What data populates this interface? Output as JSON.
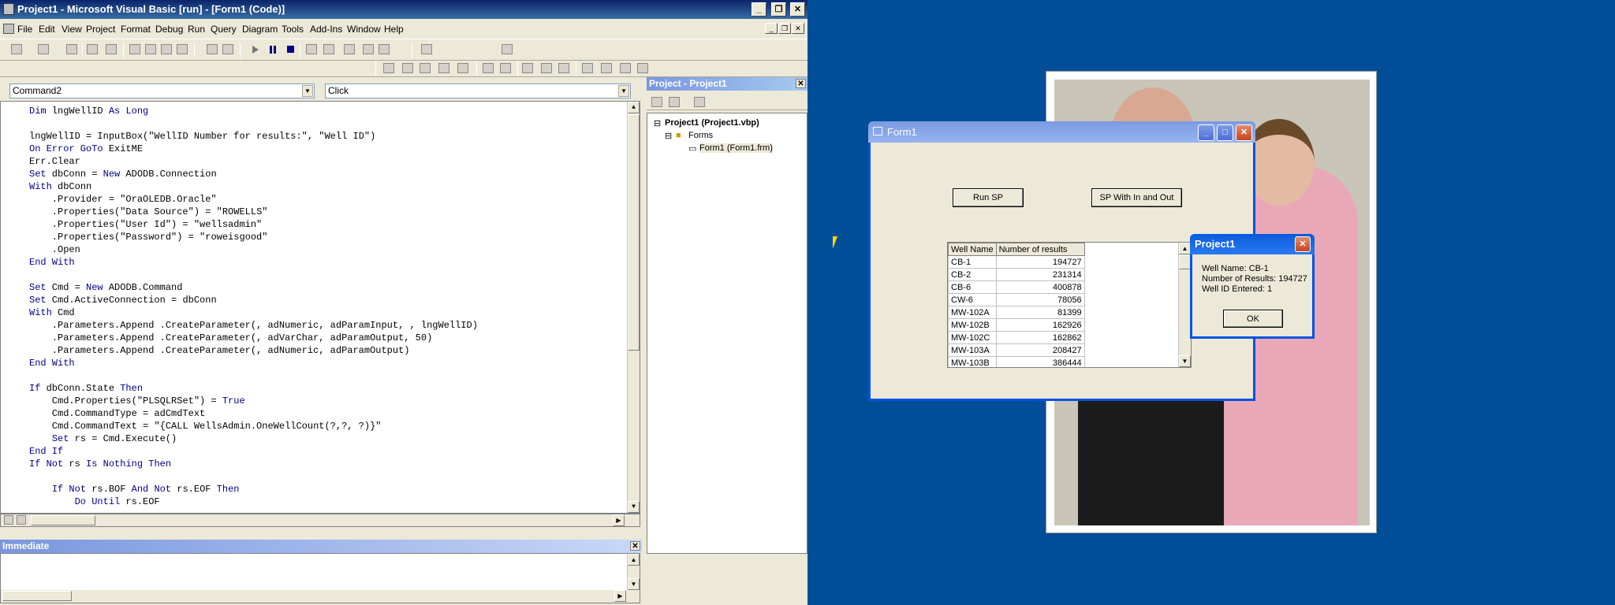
{
  "ide": {
    "title": "Project1 - Microsoft Visual Basic [run] - [Form1 (Code)]",
    "menu": [
      "File",
      "Edit",
      "View",
      "Project",
      "Format",
      "Debug",
      "Run",
      "Query",
      "Diagram",
      "Tools",
      "Add-Ins",
      "Window",
      "Help"
    ],
    "object_combo": "Command2",
    "proc_combo": "Click",
    "code_lines": [
      "Dim lngWellID As Long",
      "",
      "lngWellID = InputBox(\"WellID Number for results:\", \"Well ID\")",
      "On Error GoTo ExitME",
      "Err.Clear",
      "Set dbConn = New ADODB.Connection",
      "With dbConn",
      "    .Provider = \"OraOLEDB.Oracle\"",
      "    .Properties(\"Data Source\") = \"ROWELLS\"",
      "    .Properties(\"User Id\") = \"wellsadmin\"",
      "    .Properties(\"Password\") = \"roweisgood\"",
      "    .Open",
      "End With",
      "",
      "Set Cmd = New ADODB.Command",
      "Set Cmd.ActiveConnection = dbConn",
      "With Cmd",
      "    .Parameters.Append .CreateParameter(, adNumeric, adParamInput, , lngWellID)",
      "    .Parameters.Append .CreateParameter(, adVarChar, adParamOutput, 50)",
      "    .Parameters.Append .CreateParameter(, adNumeric, adParamOutput)",
      "End With",
      "",
      "If dbConn.State Then",
      "    Cmd.Properties(\"PLSQLRSet\") = True",
      "    Cmd.CommandType = adCmdText",
      "    Cmd.CommandText = \"{CALL WellsAdmin.OneWellCount(?,?, ?)}\"",
      "    Set rs = Cmd.Execute()",
      "End If",
      "If Not rs Is Nothing Then",
      "",
      "    If Not rs.BOF And Not rs.EOF Then",
      "        Do Until rs.EOF"
    ],
    "project_panel": {
      "title": "Project - Project1",
      "root": "Project1 (Project1.vbp)",
      "folder": "Forms",
      "item": "Form1 (Form1.frm)"
    },
    "immediate_title": "Immediate"
  },
  "form1": {
    "title": "Form1",
    "btn_run": "Run SP",
    "btn_inout": "SP With In and Out",
    "grid_headers": [
      "Well Name",
      "Number of results"
    ],
    "grid_rows": [
      [
        "CB-1",
        "194727"
      ],
      [
        "CB-2",
        "231314"
      ],
      [
        "CB-6",
        "400878"
      ],
      [
        "CW-6",
        "78056"
      ],
      [
        "MW-102A",
        "81399"
      ],
      [
        "MW-102B",
        "162926"
      ],
      [
        "MW-102C",
        "162862"
      ],
      [
        "MW-103A",
        "208427"
      ],
      [
        "MW-103B",
        "386444"
      ]
    ]
  },
  "msgbox": {
    "title": "Project1",
    "line1": "Well Name: CB-1",
    "line2": "Number of Results: 194727",
    "line3": "Well ID Entered: 1",
    "ok": "OK"
  }
}
